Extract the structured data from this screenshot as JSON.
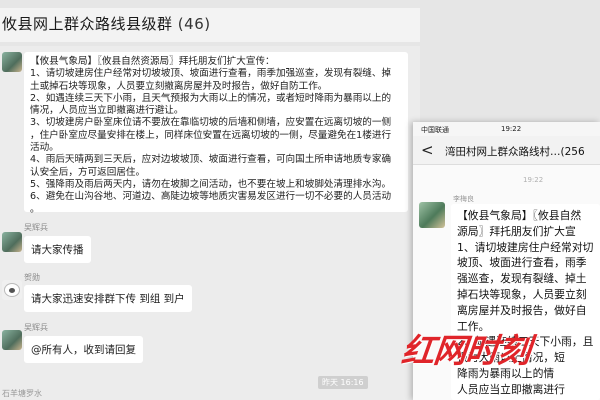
{
  "window": {
    "title": "攸县网上群众路线县级群",
    "count": "(46)"
  },
  "messages": [
    {
      "sender": "",
      "lines": [
        "【攸县气象局】〖攸县自然资源局〗拜托朋友们扩大宣传：",
        "1、请切坡建房住户经常对切坡坡顶、坡面进行查看，雨季加强巡查，发现有裂缝、掉",
        "土或掉石块等现象，人员要立刻撤离房屋并及时报告，做好自防工作。",
        "2、如遇连续三天下小雨，且天气预报为大雨以上的情况，或者短时降雨为暴雨以上的",
        "情况，人员应当立即撤离进行避让。",
        "3、切坡建房户卧室床位请不要放在靠临切坡的后墙和侧墙，应安置在远离切坡的一侧",
        "，住户卧室应尽量安排在楼上，同样床位安置在远离切坡的一侧，尽量避免在1楼进行",
        "活动。",
        "4、雨后天晴两到三天后，应对边坡坡顶、坡面进行查看，可向国土所申请地质专家确",
        "认安全后，方可返回居住。",
        "5、强降雨及雨后两天内，请勿在坡脚之间活动，也不要在坡上和坡脚处清理排水沟。",
        "6、避免在山沟谷地、河道边、高陡边坡等地质灾害易发区进行一切不必要的人员活动",
        "。"
      ]
    },
    {
      "sender": "吴辉兵",
      "text": "请大家传播"
    },
    {
      "sender": "贺勋",
      "text": "请大家迅速安排群下传  到组  到户"
    },
    {
      "sender": "吴辉兵",
      "text": "@所有人，收到请回复"
    }
  ],
  "timestamp": "昨天 16:16",
  "bottom_partial": "石羊塘罗水",
  "phone": {
    "carrier": "中国联通",
    "time": "19:22",
    "title": "湾田村网上群众路线村…",
    "title_count": "(256",
    "chat_time": "19:22",
    "sender": "李梅良",
    "lines": [
      "【攸县气象局】〖攸县自然",
      "源局〗拜托朋友们扩大宣",
      "1、请切坡建房住户经常对切",
      "坡顶、坡面进行查看，雨季",
      "强巡查，发现有裂缝、掉土",
      "掉石块等现象，人员要立刻",
      "离房屋并及时报告，做好自",
      "工作。",
      "2、如遇连续三天下小雨，且",
      "报为大雨以上情况，短",
      "降雨为暴雨以上的情",
      "人员应当立即撤离进行"
    ]
  },
  "watermark": "红网时刻"
}
